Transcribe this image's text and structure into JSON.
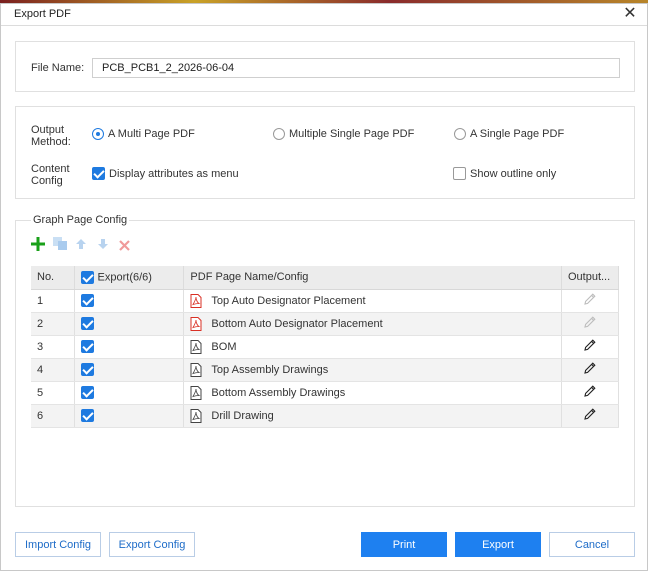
{
  "window": {
    "title": "Export PDF",
    "close_icon": "close-icon"
  },
  "file": {
    "label": "File Name:",
    "value": "PCB_PCB1_2_2026-06-04"
  },
  "output": {
    "label_line1": "Output",
    "label_line2": "Method:",
    "options": [
      {
        "label": "A Multi Page PDF",
        "selected": true
      },
      {
        "label": "Multiple Single Page PDF",
        "selected": false
      },
      {
        "label": "A Single Page PDF",
        "selected": false
      }
    ]
  },
  "content": {
    "label_line1": "Content",
    "label_line2": "Config",
    "display_attrs": {
      "label": "Display attributes as menu",
      "checked": true
    },
    "outline_only": {
      "label": "Show outline only",
      "checked": false
    }
  },
  "graph": {
    "legend": "Graph Page Config",
    "toolbar": [
      "add-icon",
      "copy-icon",
      "move-up-icon",
      "move-down-icon",
      "delete-icon"
    ],
    "columns": {
      "no": "No.",
      "export": "Export(6/6)",
      "name": "PDF Page Name/Config",
      "output": "Output..."
    },
    "rows": [
      {
        "no": "1",
        "export": true,
        "name": "Top Auto Designator Placement",
        "icon_color": "#d93025",
        "edit_enabled": false
      },
      {
        "no": "2",
        "export": true,
        "name": "Bottom Auto Designator Placement",
        "icon_color": "#d93025",
        "edit_enabled": false
      },
      {
        "no": "3",
        "export": true,
        "name": "BOM",
        "icon_color": "#444444",
        "edit_enabled": true
      },
      {
        "no": "4",
        "export": true,
        "name": "Top Assembly Drawings",
        "icon_color": "#444444",
        "edit_enabled": true
      },
      {
        "no": "5",
        "export": true,
        "name": "Bottom Assembly Drawings",
        "icon_color": "#444444",
        "edit_enabled": true
      },
      {
        "no": "6",
        "export": true,
        "name": "Drill Drawing",
        "icon_color": "#444444",
        "edit_enabled": true
      }
    ]
  },
  "buttons": {
    "import": "Import Config",
    "export_config": "Export Config",
    "print": "Print",
    "export": "Export",
    "cancel": "Cancel"
  },
  "colors": {
    "accent": "#1e80f0",
    "add": "#1aa01a",
    "delete": "#e05a5a"
  }
}
